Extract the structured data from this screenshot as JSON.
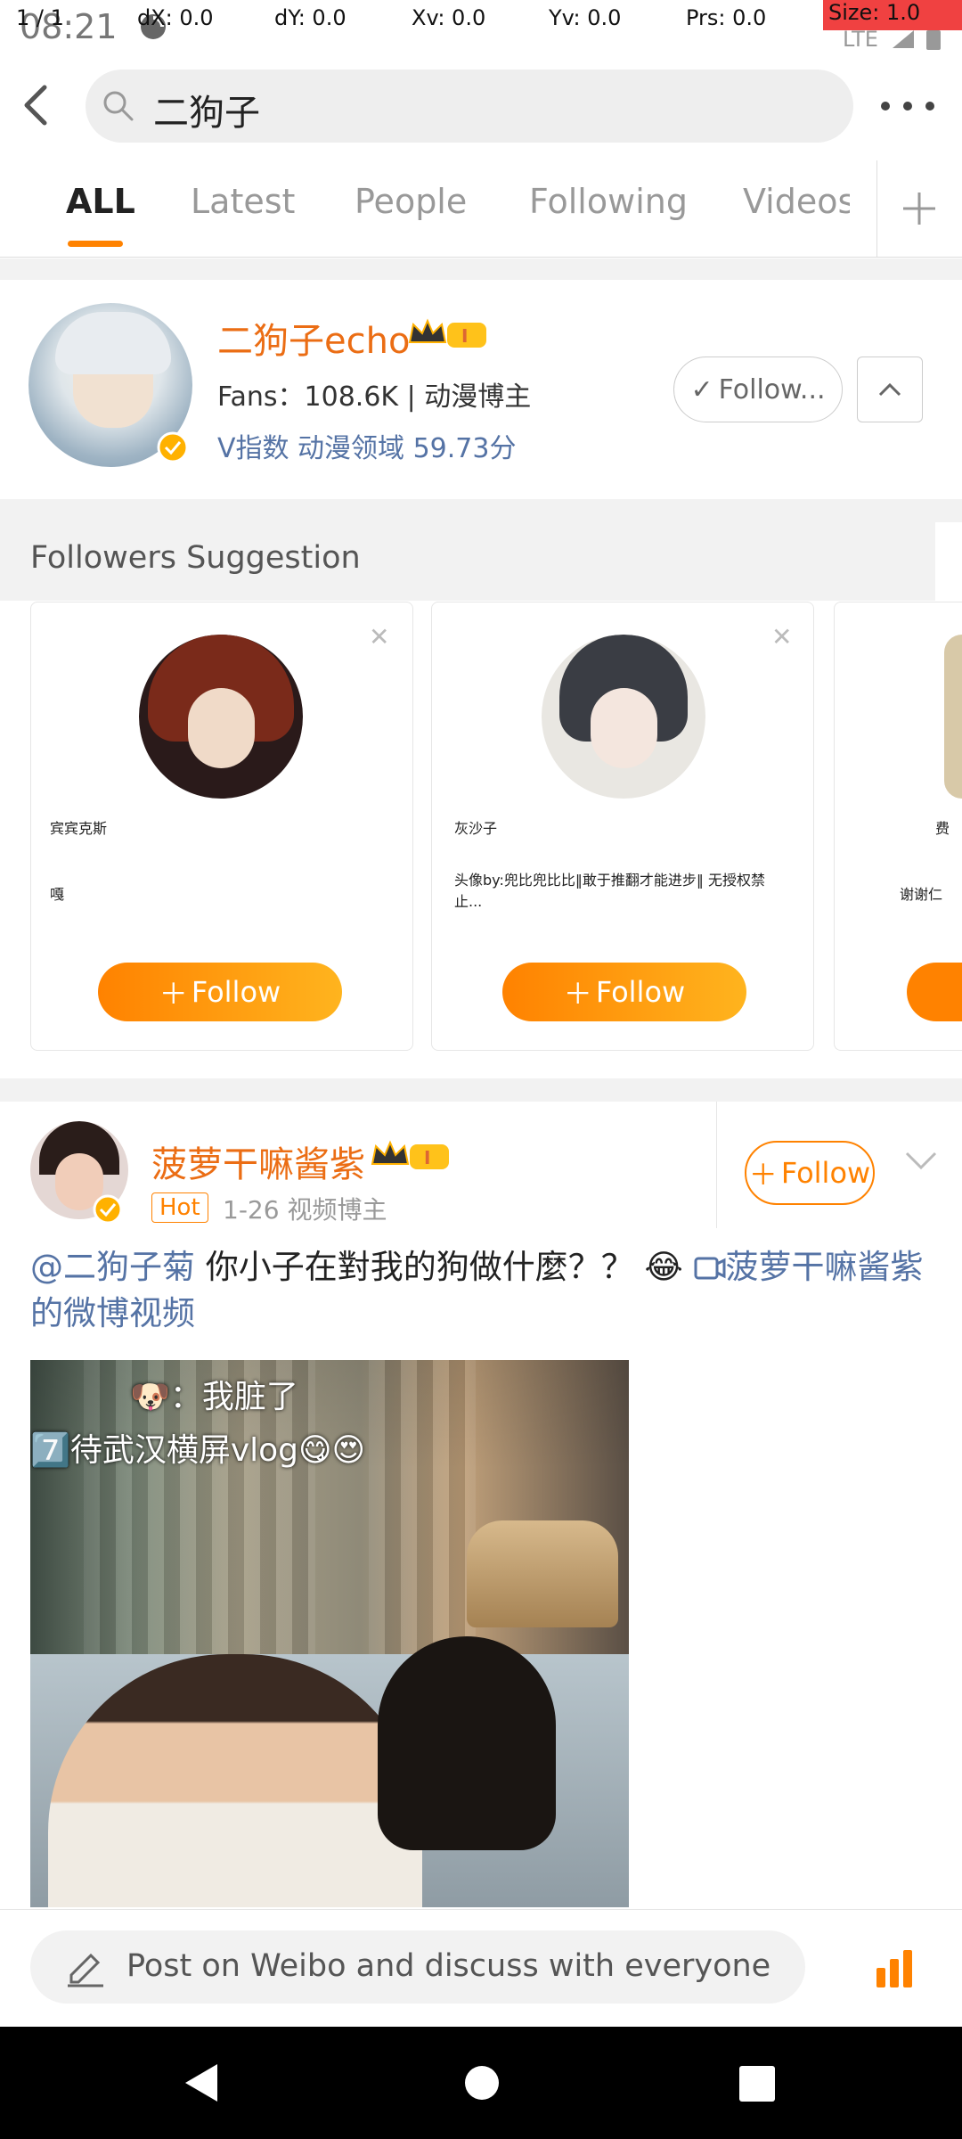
{
  "status_bar": {
    "time": "08:21",
    "pointer_readout": [
      "1 / 1",
      "dX: 0.0",
      "dY: 0.0",
      "Xv: 0.0",
      "Yv: 0.0",
      "Prs: 0.0",
      "Size: 1.0"
    ]
  },
  "search": {
    "query": "二狗子"
  },
  "tabs": [
    "ALL",
    "Latest",
    "People",
    "Following",
    "Videos"
  ],
  "user_card": {
    "name": "二狗子echo",
    "fans": "Fans：108.6K | 动漫博主",
    "index": "V指数 动漫领域 59.73分",
    "follow_label": "Follow...",
    "follow_check": "✓"
  },
  "suggestions": {
    "title": "Followers Suggestion",
    "follow_label": "Follow",
    "cards": [
      {
        "name": "宾宾克斯",
        "desc": "嘎"
      },
      {
        "name": "灰沙子",
        "desc": "头像by:兜比兜比比‖敢于推翻才能进步‖ 无授权禁止..."
      },
      {
        "name": "费",
        "desc": "谢谢仁"
      }
    ]
  },
  "post": {
    "author": "菠萝干嘛酱紫",
    "hot": "Hot",
    "meta": "1-26  视频博主",
    "follow_label": "Follow",
    "mention": "@二狗子菊",
    "text": " 你小子在對我的狗做什麼？？ 😂 ",
    "video_link": "菠萝干嘛酱紫的微博视频",
    "video_caption_1": "🐶：我脏了",
    "video_caption_2": "7️⃣待武汉横屏vlog😋😍"
  },
  "compose": {
    "placeholder": "Post on Weibo and discuss with everyone"
  },
  "colors": {
    "accent": "#ff8200",
    "name_orange": "#eb6d14",
    "link": "#5573a5"
  }
}
